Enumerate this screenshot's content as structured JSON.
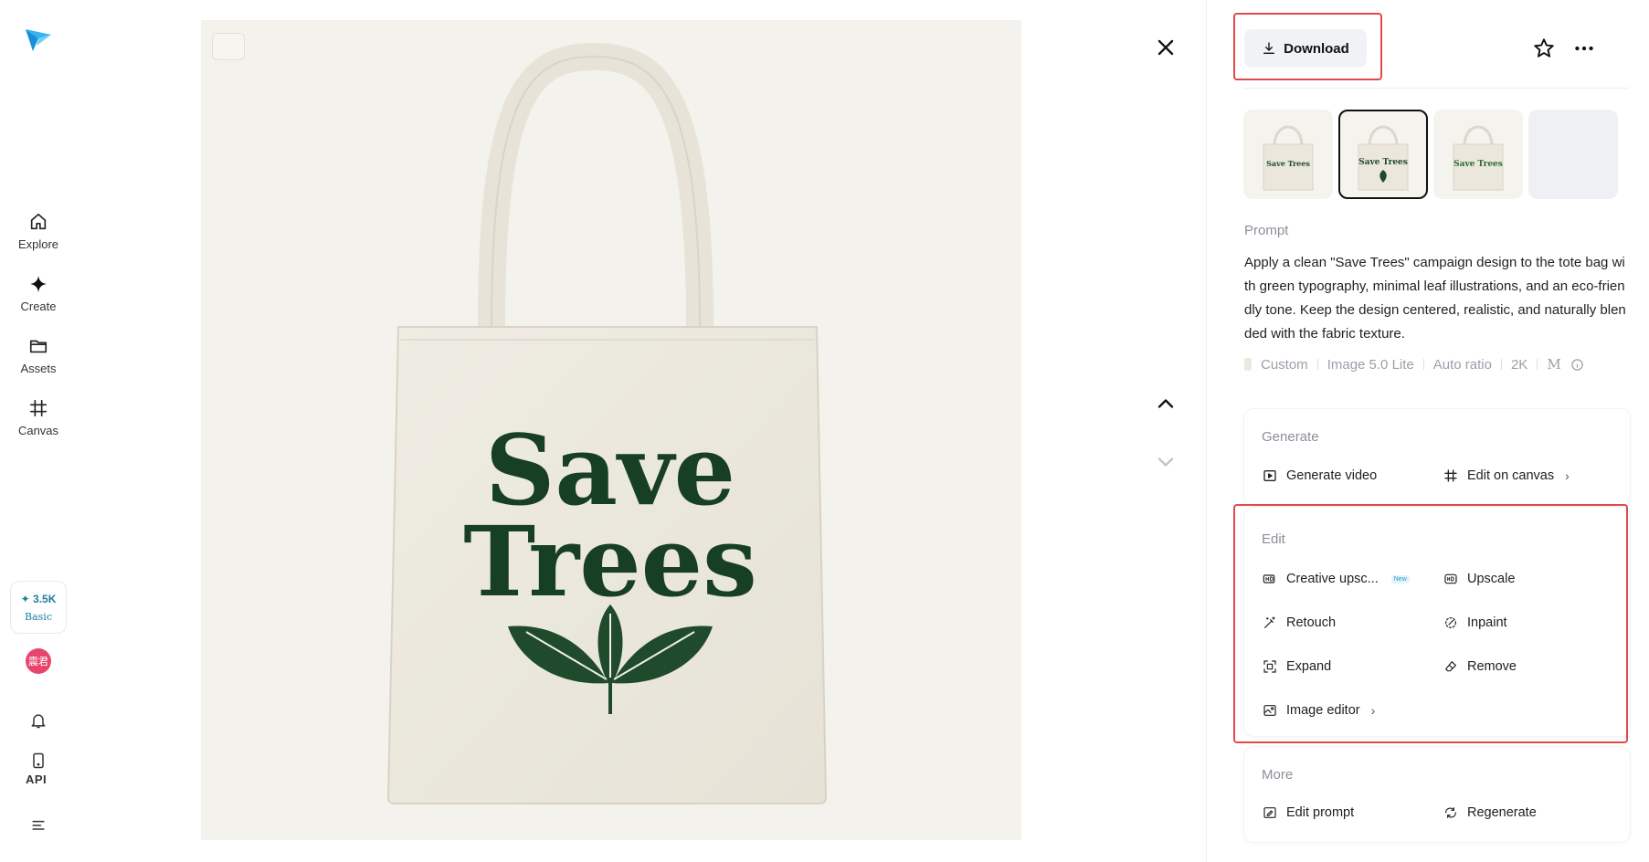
{
  "rail": {
    "nav": [
      {
        "label": "Explore",
        "icon": "home-icon"
      },
      {
        "label": "Create",
        "icon": "sparkle-icon"
      },
      {
        "label": "Assets",
        "icon": "folder-icon"
      },
      {
        "label": "Canvas",
        "icon": "canvas-icon"
      }
    ],
    "credits": {
      "amount": "3.5K",
      "tier": "Basic"
    },
    "avatar_text": "震君",
    "api_label": "API"
  },
  "image": {
    "bag_text_line1": "Save",
    "bag_text_line2": "Trees"
  },
  "panel": {
    "download_label": "Download",
    "thumbnails": [
      {
        "text": "Save Trees",
        "selected": false
      },
      {
        "text": "Save Trees",
        "selected": true
      },
      {
        "text": "Save Trees",
        "selected": false
      },
      {
        "text": "",
        "selected": false
      }
    ],
    "prompt_title": "Prompt",
    "prompt_text": "Apply a clean \"Save Trees\" campaign design to the tote bag with green typography, minimal leaf illustrations, and an eco-friendly tone. Keep the design centered, realistic, and naturally blended with the fabric texture.",
    "meta": {
      "style": "Custom",
      "model": "Image 5.0 Lite",
      "ratio": "Auto ratio",
      "resolution": "2K",
      "extra": "M"
    },
    "generate": {
      "title": "Generate",
      "generate_video": "Generate video",
      "edit_on_canvas": "Edit on canvas"
    },
    "edit": {
      "title": "Edit",
      "creative_upscale": "Creative upsc...",
      "new_badge": "New",
      "upscale": "Upscale",
      "retouch": "Retouch",
      "inpaint": "Inpaint",
      "expand": "Expand",
      "remove": "Remove",
      "image_editor": "Image editor"
    },
    "more": {
      "title": "More",
      "edit_prompt": "Edit prompt",
      "regenerate": "Regenerate"
    }
  },
  "colors": {
    "accent_green": "#173f23",
    "highlight_red": "#e24a4a",
    "credits_blue": "#1d7fa5"
  }
}
